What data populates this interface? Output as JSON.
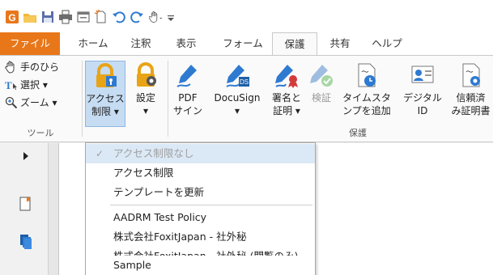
{
  "quick_access": {
    "icons": [
      "app-logo-icon",
      "open-folder-icon",
      "save-icon",
      "print-icon",
      "window-icon",
      "new-icon",
      "undo-icon",
      "redo-icon",
      "hand-tool-icon",
      "customize-icon"
    ]
  },
  "tabs": [
    {
      "label": "ファイル",
      "state": "file"
    },
    {
      "label": "ホーム",
      "state": "normal"
    },
    {
      "label": "注釈",
      "state": "normal"
    },
    {
      "label": "表示",
      "state": "normal"
    },
    {
      "label": "フォーム",
      "state": "normal"
    },
    {
      "label": "保護",
      "state": "active"
    },
    {
      "label": "共有",
      "state": "normal"
    },
    {
      "label": "ヘルプ",
      "state": "normal"
    }
  ],
  "ribbon": {
    "tools_group": {
      "label": "ツール",
      "items": [
        {
          "label": "手のひら",
          "icon": "hand-icon"
        },
        {
          "label": "選択 ▾",
          "icon": "select-text-icon"
        },
        {
          "label": "ズーム ▾",
          "icon": "zoom-icon"
        }
      ]
    },
    "protect_group": {
      "label": "保護",
      "buttons": [
        {
          "line1": "アクセス",
          "line2": "制限 ▾",
          "icon": "access-restrict-icon",
          "state": "pressed"
        },
        {
          "line1": "設定",
          "line2": "▾",
          "icon": "settings-lock-icon",
          "state": "normal"
        },
        {
          "line1": "PDF",
          "line2": "サイン",
          "icon": "pdf-sign-icon",
          "state": "normal"
        },
        {
          "line1": "DocuSign",
          "line2": "▾",
          "icon": "docusign-icon",
          "state": "normal"
        },
        {
          "line1": "署名と",
          "line2": "証明 ▾",
          "icon": "sign-certify-icon",
          "state": "normal"
        },
        {
          "line1": "検証",
          "line2": "",
          "icon": "validate-icon",
          "state": "disabled"
        },
        {
          "line1": "タイムスタ",
          "line2": "ンプを追加",
          "icon": "timestamp-icon",
          "state": "normal"
        },
        {
          "line1": "デジタル",
          "line2": "ID",
          "icon": "digital-id-icon",
          "state": "normal"
        },
        {
          "line1": "信頼済",
          "line2": "み証明書",
          "icon": "trusted-cert-icon",
          "state": "normal"
        }
      ]
    }
  },
  "dropdown": {
    "items": [
      {
        "label": "アクセス制限なし",
        "state": "disabled",
        "checked": true
      },
      {
        "label": "アクセス制限",
        "state": "normal"
      },
      {
        "label": "テンプレートを更新",
        "state": "normal"
      },
      {
        "label": "AADRM Test Policy",
        "state": "normal"
      },
      {
        "label": "株式会社FoxitJapan - 社外秘",
        "state": "normal"
      },
      {
        "label": "株式会社FoxitJapan - 社外秘 (閲覧のみ)",
        "state": "normal"
      },
      {
        "label": "Sample",
        "state": "normal"
      }
    ],
    "check_mark": "✓"
  },
  "left_panel": {
    "icons": [
      "expand-arrow-icon",
      "bookmark-icon",
      "pages-icon"
    ]
  },
  "colors": {
    "file_tab": "#e8771a",
    "accent_blue": "#2f7ad1",
    "lock_gold": "#e8a416",
    "pressed_bg": "#c5dcf2"
  }
}
